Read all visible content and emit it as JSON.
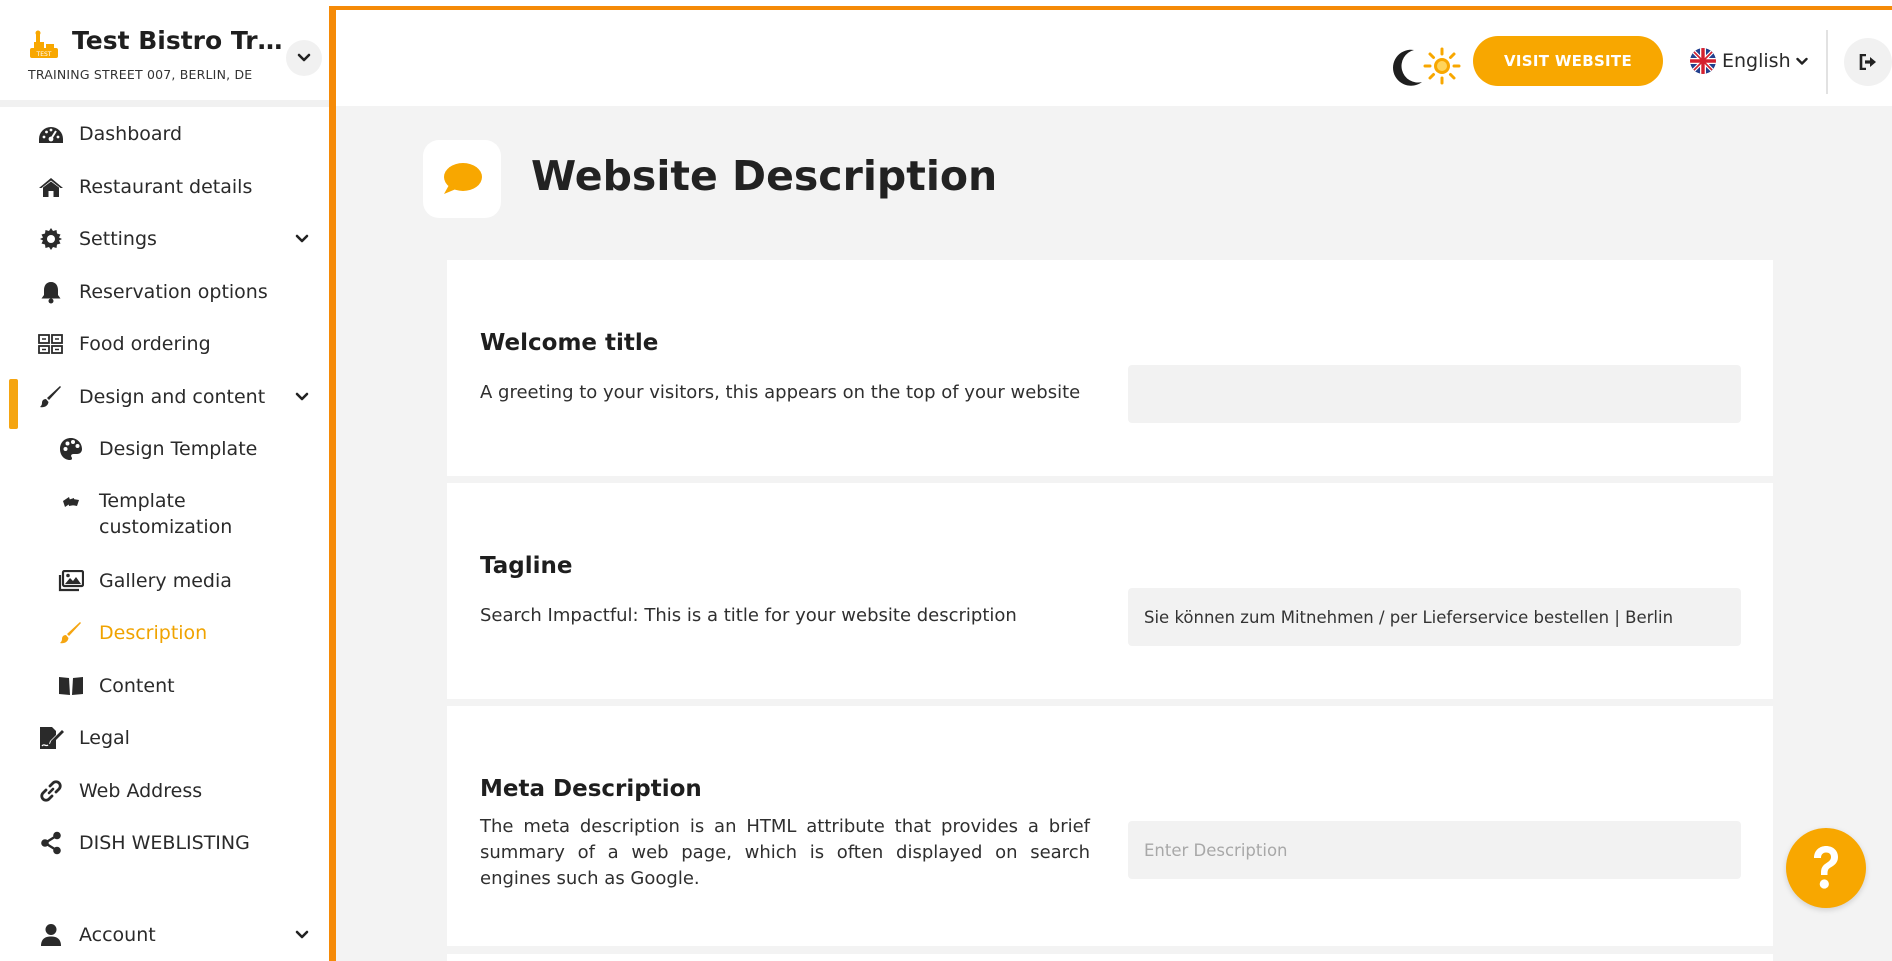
{
  "brand": {
    "name": "Test Bistro Train...",
    "address": "TRAINING STREET 007, BERLIN, DE"
  },
  "sidebar": {
    "items": [
      {
        "label": "Dashboard",
        "icon": "dashboard-icon"
      },
      {
        "label": "Restaurant details",
        "icon": "home-icon"
      },
      {
        "label": "Settings",
        "icon": "gear-icon"
      },
      {
        "label": "Reservation options",
        "icon": "bell-icon"
      },
      {
        "label": "Food ordering",
        "icon": "food-ordering-icon"
      },
      {
        "label": "Design and content",
        "icon": "brush-icon"
      },
      {
        "label": "Design Template",
        "icon": "palette-icon"
      },
      {
        "label": "Template",
        "label2": "customization",
        "icon": "swatches-icon"
      },
      {
        "label": "Gallery media",
        "icon": "gallery-icon"
      },
      {
        "label": "Description",
        "icon": "brush-icon"
      },
      {
        "label": "Content",
        "icon": "book-icon"
      },
      {
        "label": "Legal",
        "icon": "signature-icon"
      },
      {
        "label": "Web Address",
        "icon": "link-icon"
      },
      {
        "label": "DISH WEBLISTING",
        "icon": "share-icon"
      },
      {
        "label": "Account",
        "icon": "user-icon"
      }
    ]
  },
  "topbar": {
    "visit_label": "VISIT WEBSITE",
    "language": "English"
  },
  "page": {
    "title": "Website Description"
  },
  "sections": {
    "welcome": {
      "title": "Welcome title",
      "description": "A greeting to your visitors, this appears on the top of your website",
      "value": ""
    },
    "tagline": {
      "title": "Tagline",
      "description": "Search Impactful: This is a title for your website description",
      "value": "Sie können zum Mitnehmen / per Lieferservice bestellen | Berlin"
    },
    "meta": {
      "title": "Meta Description",
      "description": "The meta description is an HTML attribute that provides a brief summary of a web page, which is often displayed on search engines such as Google.",
      "placeholder": "Enter Description",
      "value": ""
    }
  },
  "colors": {
    "accent": "#f8a700",
    "frame": "#f58a07"
  }
}
